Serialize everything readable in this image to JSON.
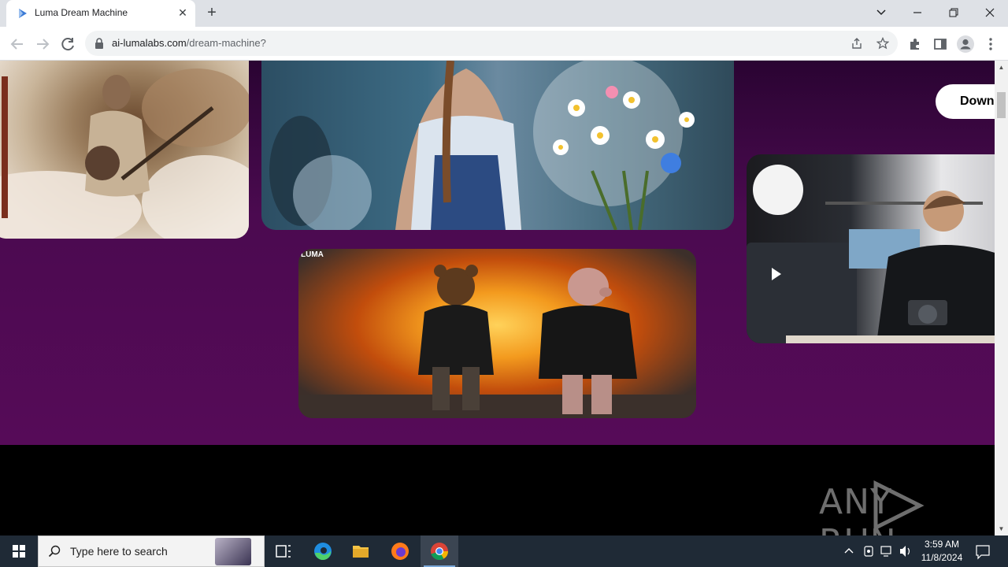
{
  "browser": {
    "tab_title": "Luma Dream Machine",
    "url_domain": "ai-lumalabs.com",
    "url_path": "/dream-machine?"
  },
  "page": {
    "download_label": "Down",
    "luma_tag": "LUMA",
    "watermark": "ANY RUN",
    "colors": {
      "background_purple": "#4a0a4e",
      "footer": "#000000",
      "button_bg": "#ffffff"
    }
  },
  "taskbar": {
    "search_placeholder": "Type here to search",
    "time": "3:59 AM",
    "date": "11/8/2024"
  },
  "icons": [
    "luma-favicon-icon",
    "close-icon",
    "plus-icon",
    "chevron-down-icon",
    "minimize-icon",
    "restore-icon",
    "back-icon",
    "forward-icon",
    "reload-icon",
    "lock-icon",
    "share-icon",
    "star-icon",
    "extensions-icon",
    "sidepanel-icon",
    "profile-icon",
    "kebab-menu-icon",
    "windows-start-icon",
    "search-icon",
    "task-view-icon",
    "edge-icon",
    "file-explorer-icon",
    "firefox-icon",
    "chrome-icon",
    "chevron-up-icon",
    "network-icon",
    "volume-icon",
    "notification-icon"
  ]
}
